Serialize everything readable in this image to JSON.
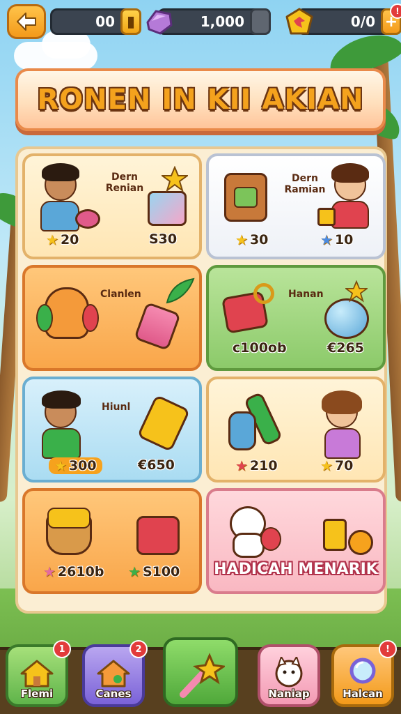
{
  "topbar": {
    "coins": "00",
    "gems": "1,000",
    "energy": "0/0",
    "energy_plus": "+",
    "alert_badge": "!"
  },
  "banner": {
    "title": "RONEN IN KII AKIAN"
  },
  "cards": [
    {
      "label": "Dern\nRenian",
      "price_left": "20",
      "price_right": "S30",
      "color": "#ffe6b4"
    },
    {
      "label": "Dern\nRamian",
      "price_left": "30",
      "price_right": "10",
      "color": "#eef1f7"
    },
    {
      "label": "Clanlen",
      "price_left": "",
      "price_right": "",
      "color": "#f9a64a"
    },
    {
      "label": "Hanan",
      "price_left": "c100ob",
      "price_right": "€265",
      "color": "#8cca6a"
    },
    {
      "label": "Hiunl",
      "price_left": "300",
      "price_right": "€650",
      "color": "#aadcf2"
    },
    {
      "label": "",
      "price_left": "210",
      "price_right": "70",
      "color": "#ffe6b4"
    },
    {
      "label": "",
      "price_left": "2610b",
      "price_right": "S100",
      "color": "#f9a64a"
    },
    {
      "label": "HADICAH MENARIK",
      "price_left": "",
      "price_right": "",
      "color": "#f9b8c2"
    }
  ],
  "nav": {
    "items": [
      {
        "label": "Flemi",
        "badge": "1",
        "icon": "home-icon"
      },
      {
        "label": "Canes",
        "badge": "2",
        "icon": "house-icon"
      },
      {
        "label": "",
        "badge": "",
        "icon": "star-wand-icon"
      },
      {
        "label": "Naniap",
        "badge": "",
        "icon": "cat-icon"
      },
      {
        "label": "Halcan",
        "badge": "!",
        "icon": "mirror-icon"
      }
    ]
  }
}
